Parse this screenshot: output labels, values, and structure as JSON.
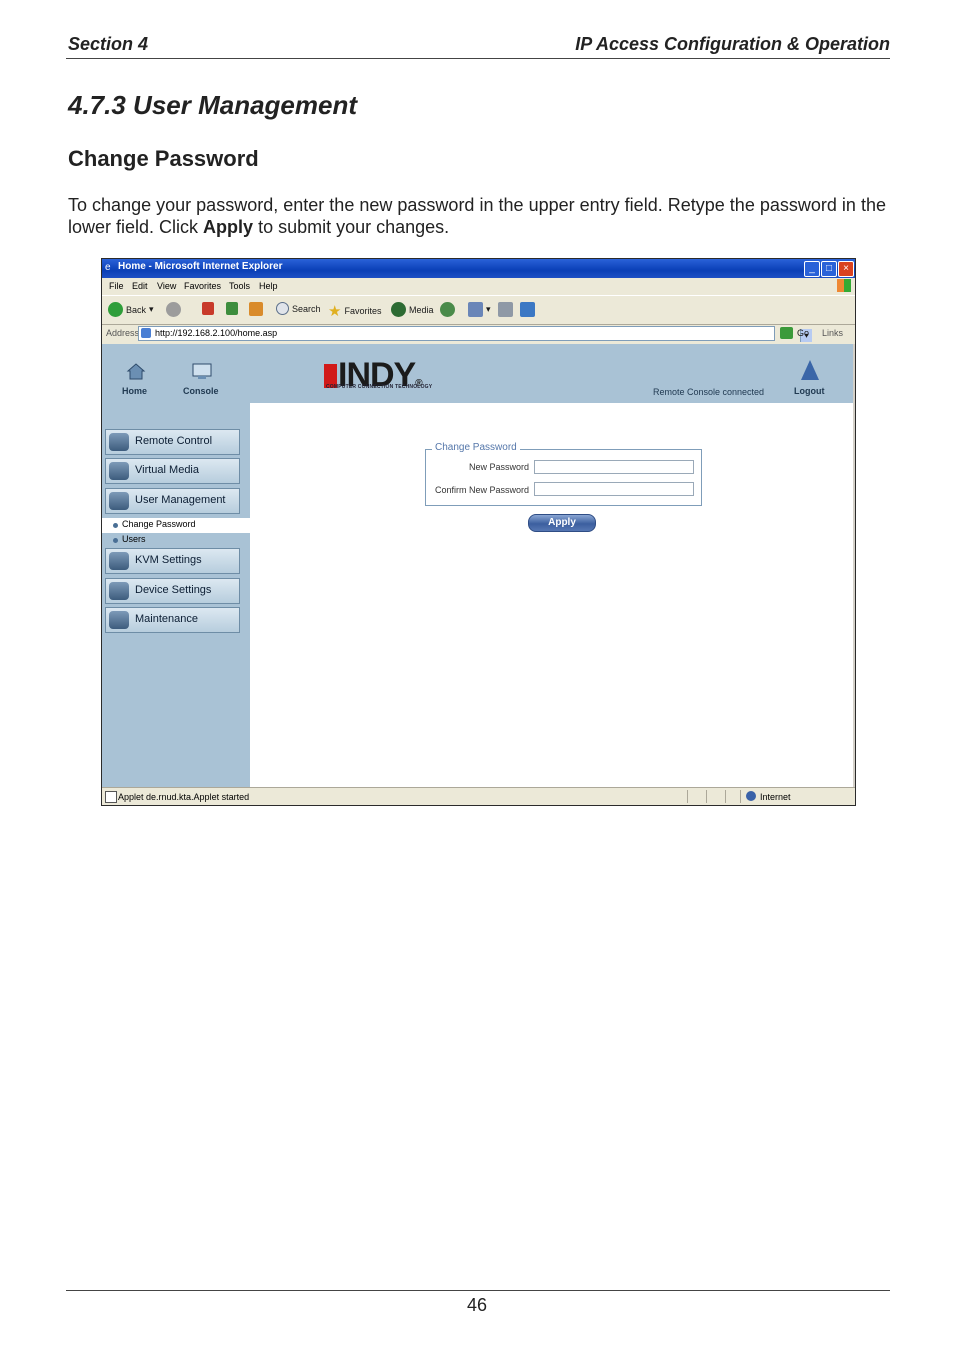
{
  "doc": {
    "header_left": "Section 4",
    "header_right": "IP Access Configuration & Operation",
    "section_title": "4.7.3  User Management",
    "subsection_title": "Change Password",
    "paragraph_before": "To change your password, enter the new password in the upper entry field. Retype the password in the lower field. Click ",
    "paragraph_bold": "Apply",
    "paragraph_after": " to submit your changes.",
    "page_number": "46"
  },
  "browser": {
    "window_title": "Home - Microsoft Internet Explorer",
    "menu": [
      "File",
      "Edit",
      "View",
      "Favorites",
      "Tools",
      "Help"
    ],
    "toolbar": {
      "back": "Back",
      "search": "Search",
      "favorites": "Favorites",
      "media": "Media"
    },
    "address_label": "Address",
    "address_value": "http://192.168.2.100/home.asp",
    "go_label": "Go",
    "links_label": "Links",
    "status_text": "Applet de.rnud.kta.Applet started",
    "status_zone": "Internet"
  },
  "app": {
    "nav_home": "Home",
    "nav_console": "Console",
    "logo_text": "INDY",
    "logo_tagline": "COMPUTER CONNECTION TECHNOLOGY",
    "connection_status": "Remote Console connected",
    "nav_logout": "Logout",
    "menu": [
      {
        "label": "Remote Control",
        "icon": "remote-control-icon"
      },
      {
        "label": "Virtual Media",
        "icon": "virtual-media-icon"
      },
      {
        "label": "User Management",
        "icon": "user-management-icon"
      },
      {
        "label": "KVM Settings",
        "icon": "kvm-settings-icon"
      },
      {
        "label": "Device Settings",
        "icon": "device-settings-icon"
      },
      {
        "label": "Maintenance",
        "icon": "maintenance-icon"
      }
    ],
    "submenu": {
      "change_password": "Change Password",
      "users": "Users"
    },
    "form": {
      "legend": "Change Password",
      "new_password_label": "New Password",
      "new_password_value": "",
      "confirm_password_label": "Confirm New Password",
      "confirm_password_value": "",
      "apply_label": "Apply"
    }
  },
  "colors": {
    "sidebar_bg": "#a9c2d5",
    "titlebar": "#0a3fb6",
    "logo_red": "#d11919"
  }
}
